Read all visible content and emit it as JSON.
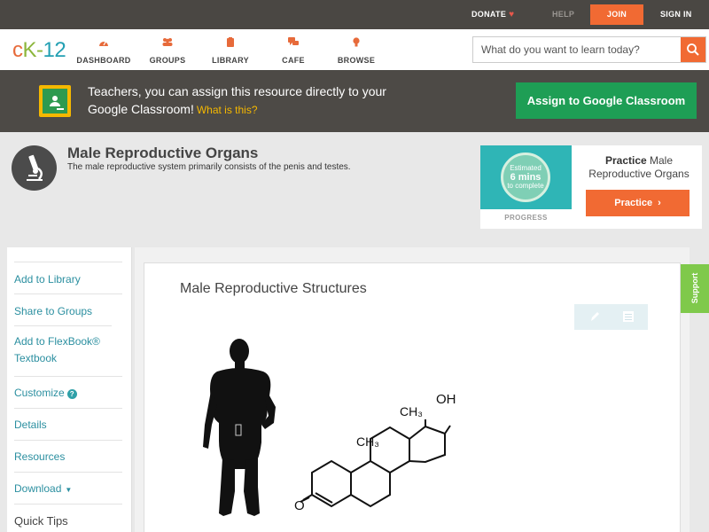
{
  "topbar": {
    "donate": "DONATE",
    "help": "HELP",
    "join": "JOIN",
    "signin": "SIGN IN"
  },
  "logo": {
    "c": "c",
    "k": "K-",
    "n": "12"
  },
  "nav": {
    "items": [
      "DASHBOARD",
      "GROUPS",
      "LIBRARY",
      "CAFE",
      "BROWSE"
    ]
  },
  "search": {
    "placeholder": "What do you want to learn today?"
  },
  "banner": {
    "text": "Teachers, you can assign this resource directly to your Google Classroom!",
    "what": "What is this?",
    "assign_button": "Assign to Google Classroom"
  },
  "concept": {
    "title": "Male Reproductive Organs",
    "description": "The male reproductive system primarily consists of the penis and testes."
  },
  "practice_card": {
    "estimated": "Estimated",
    "minutes": "6 mins",
    "to_complete": "to complete",
    "progress_label": "PROGRESS",
    "title_bold": "Practice",
    "title_rest": " Male Reproductive Organs",
    "button": "Practice"
  },
  "sidebar": {
    "items": [
      {
        "label": "Add to Library"
      },
      {
        "label": "Share to Groups"
      },
      {
        "label": "Add to FlexBook® Textbook"
      },
      {
        "label": "Customize"
      },
      {
        "label": "Details"
      },
      {
        "label": "Resources"
      },
      {
        "label": "Download"
      }
    ],
    "quick_tips": "Quick Tips"
  },
  "content": {
    "title": "Male Reproductive Structures",
    "molecule_labels": {
      "ch3_top": "CH₃",
      "oh": "OH",
      "ch3_mid": "CH₃",
      "o": "O"
    }
  },
  "support": "Support",
  "colors": {
    "accent": "#f16a33",
    "teal": "#2b8fa0",
    "green": "#1e9e55",
    "support_green": "#7fc94b"
  }
}
